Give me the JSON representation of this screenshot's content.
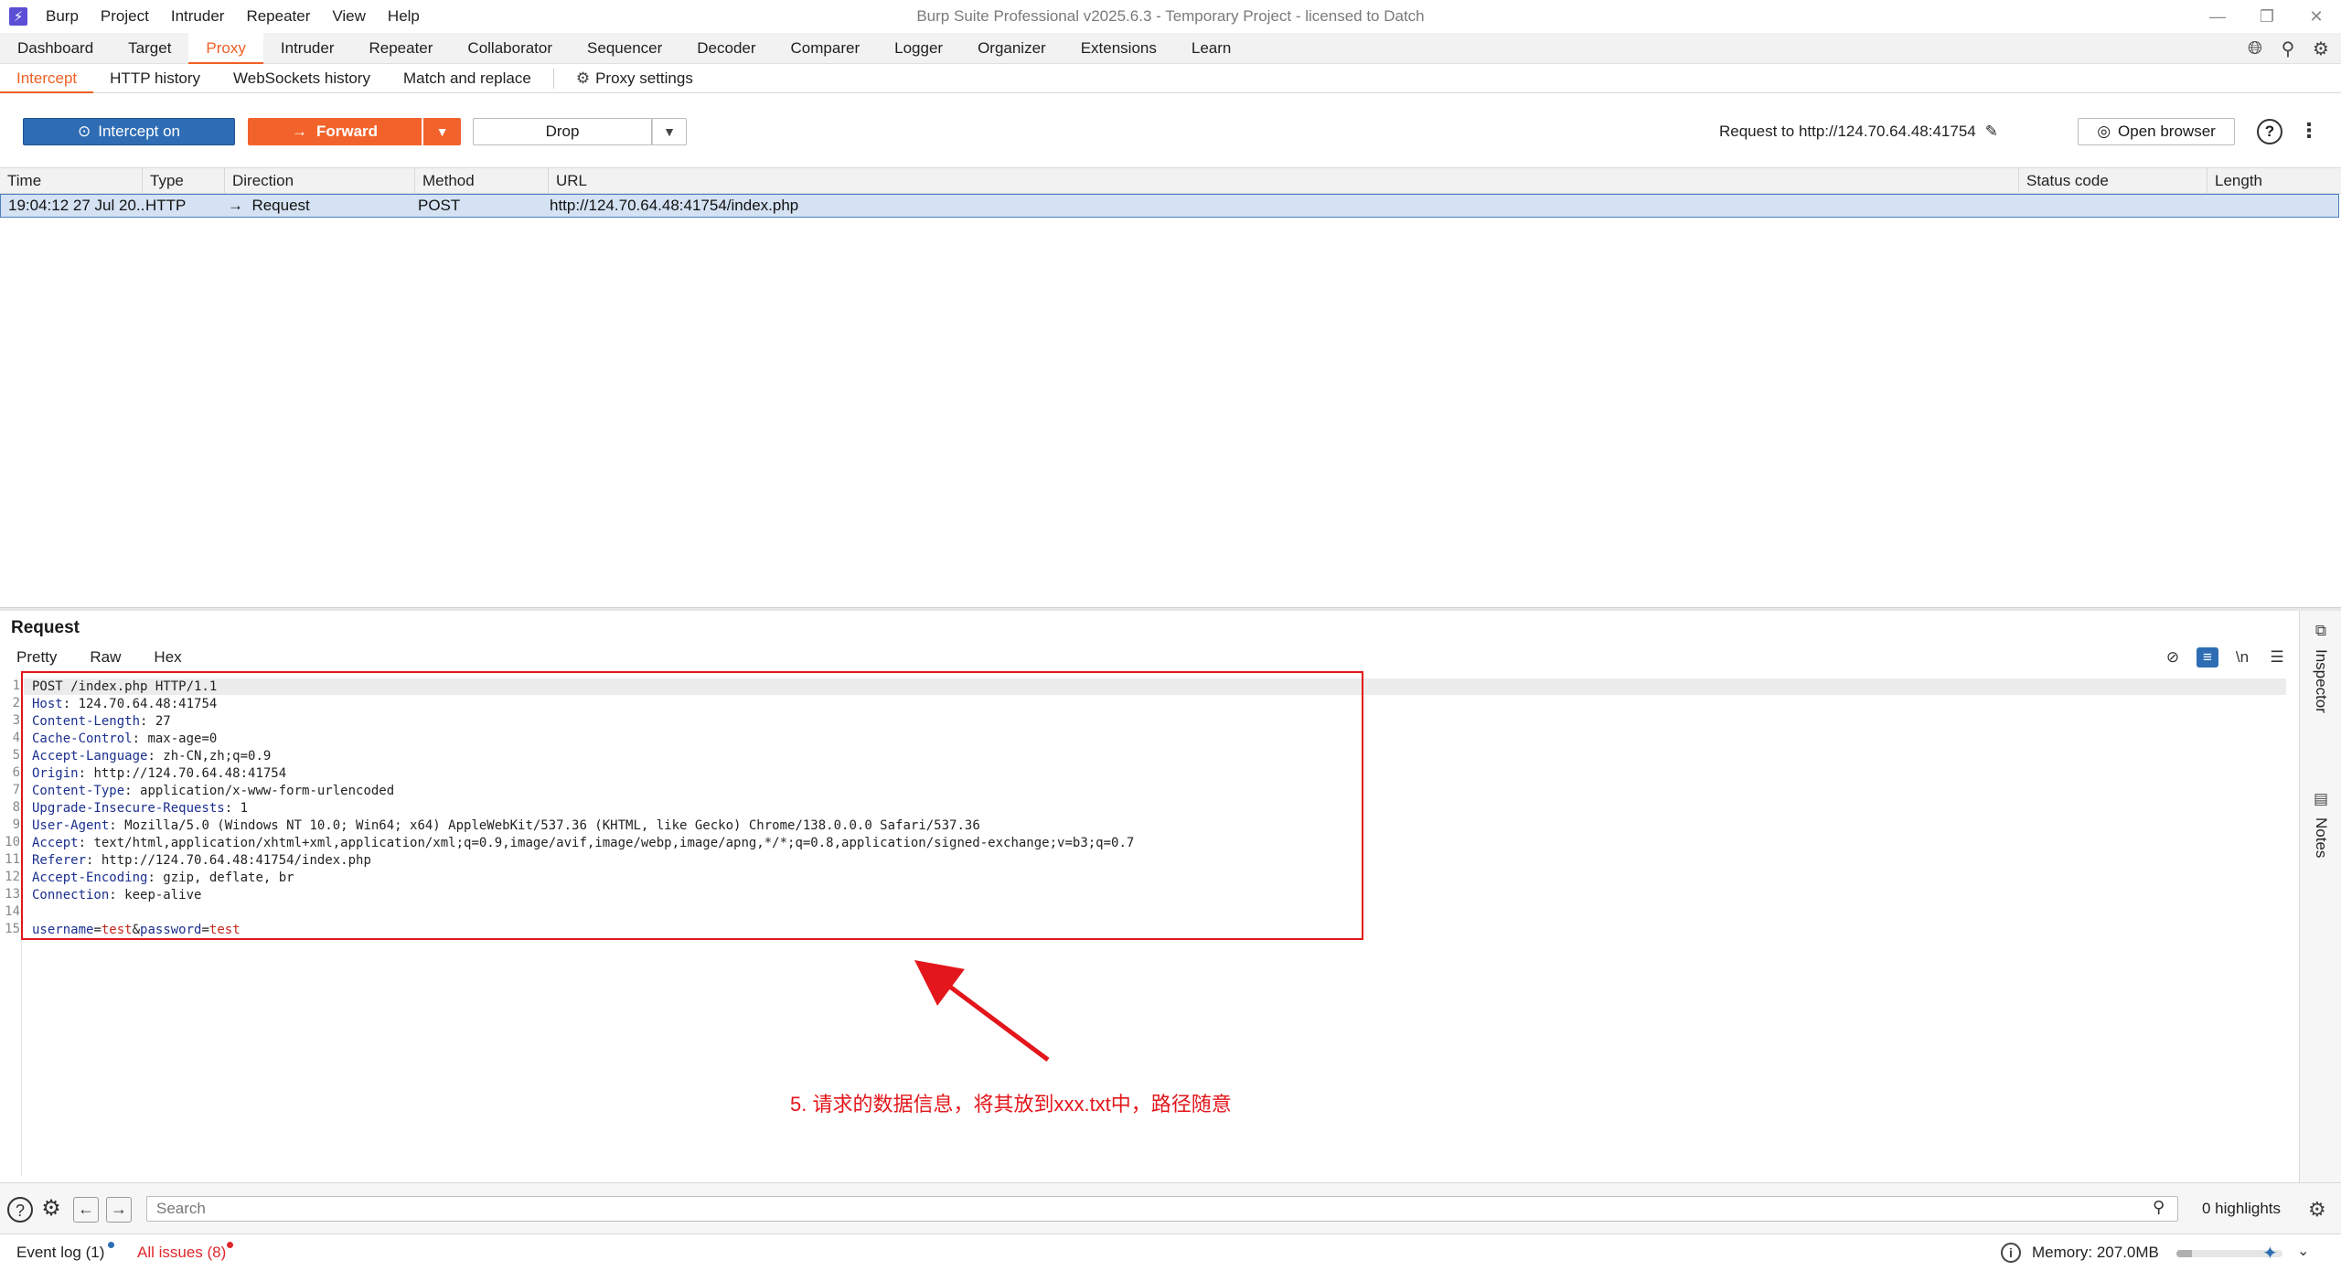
{
  "app": {
    "title": "Burp Suite Professional v2025.6.3 - Temporary Project - licensed to Datch",
    "logo": "burp-logo"
  },
  "menu": [
    "Burp",
    "Project",
    "Intruder",
    "Repeater",
    "View",
    "Help"
  ],
  "main_tabs": [
    {
      "label": "Dashboard"
    },
    {
      "label": "Target"
    },
    {
      "label": "Proxy",
      "active": true
    },
    {
      "label": "Intruder"
    },
    {
      "label": "Repeater"
    },
    {
      "label": "Collaborator"
    },
    {
      "label": "Sequencer"
    },
    {
      "label": "Decoder"
    },
    {
      "label": "Comparer"
    },
    {
      "label": "Logger"
    },
    {
      "label": "Organizer"
    },
    {
      "label": "Extensions"
    },
    {
      "label": "Learn"
    }
  ],
  "sub_tabs": [
    {
      "label": "Intercept",
      "active": true
    },
    {
      "label": "HTTP history"
    },
    {
      "label": "WebSockets history"
    },
    {
      "label": "Match and replace"
    },
    {
      "label": "Proxy settings"
    }
  ],
  "toolbar": {
    "intercept_label": "Intercept on",
    "forward_label": "Forward",
    "drop_label": "Drop",
    "request_to": "Request to http://124.70.64.48:41754",
    "open_browser_label": "Open browser"
  },
  "table": {
    "columns": [
      "Time",
      "Type",
      "Direction",
      "Method",
      "URL",
      "Status code",
      "Length"
    ],
    "rows": [
      {
        "time": "19:04:12 27 Jul 20...",
        "type": "HTTP",
        "direction": "Request",
        "method": "POST",
        "url": "http://124.70.64.48:41754/index.php",
        "status": "",
        "length": ""
      }
    ]
  },
  "request": {
    "title": "Request",
    "tabs": [
      "Pretty",
      "Raw",
      "Hex"
    ],
    "lines": [
      {
        "n": "1",
        "text": "POST /index.php HTTP/1.1"
      },
      {
        "n": "2",
        "key": "Host",
        "value": "124.70.64.48:41754"
      },
      {
        "n": "3",
        "key": "Content-Length",
        "value": "27"
      },
      {
        "n": "4",
        "key": "Cache-Control",
        "value": "max-age=0"
      },
      {
        "n": "5",
        "key": "Accept-Language",
        "value": "zh-CN,zh;q=0.9"
      },
      {
        "n": "6",
        "key": "Origin",
        "value": "http://124.70.64.48:41754"
      },
      {
        "n": "7",
        "key": "Content-Type",
        "value": "application/x-www-form-urlencoded"
      },
      {
        "n": "8",
        "key": "Upgrade-Insecure-Requests",
        "value": "1"
      },
      {
        "n": "9",
        "key": "User-Agent",
        "value": "Mozilla/5.0 (Windows NT 10.0; Win64; x64) AppleWebKit/537.36 (KHTML, like Gecko) Chrome/138.0.0.0 Safari/537.36"
      },
      {
        "n": "10",
        "key": "Accept",
        "value": "text/html,application/xhtml+xml,application/xml;q=0.9,image/avif,image/webp,image/apng,*/*;q=0.8,application/signed-exchange;v=b3;q=0.7"
      },
      {
        "n": "11",
        "key": "Referer",
        "value": "http://124.70.64.48:41754/index.php"
      },
      {
        "n": "12",
        "key": "Accept-Encoding",
        "value": "gzip, deflate, br"
      },
      {
        "n": "13",
        "key": "Connection",
        "value": "keep-alive"
      },
      {
        "n": "14",
        "text": ""
      },
      {
        "n": "15",
        "body": [
          {
            "t": "username",
            "c": "k"
          },
          {
            "t": "=",
            "c": "v"
          },
          {
            "t": "test",
            "c": "p"
          },
          {
            "t": "&",
            "c": "v"
          },
          {
            "t": "password",
            "c": "k"
          },
          {
            "t": "=",
            "c": "v"
          },
          {
            "t": "test",
            "c": "p"
          }
        ]
      }
    ],
    "newline_toggle": "\\n"
  },
  "annotation": {
    "text": "5. 请求的数据信息，将其放到xxx.txt中，路径随意",
    "color": "#e3161b"
  },
  "side_panel": [
    "Inspector",
    "Notes"
  ],
  "search": {
    "placeholder": "Search",
    "highlights": "0 highlights"
  },
  "status": {
    "event_log": "Event log (1)",
    "all_issues": "All issues (8)",
    "memory": "Memory: 207.0MB",
    "memory_fraction": 0.15
  },
  "colors": {
    "accent": "#f06025",
    "intercept": "#2e6db4",
    "selection": "#d5e2f3"
  }
}
